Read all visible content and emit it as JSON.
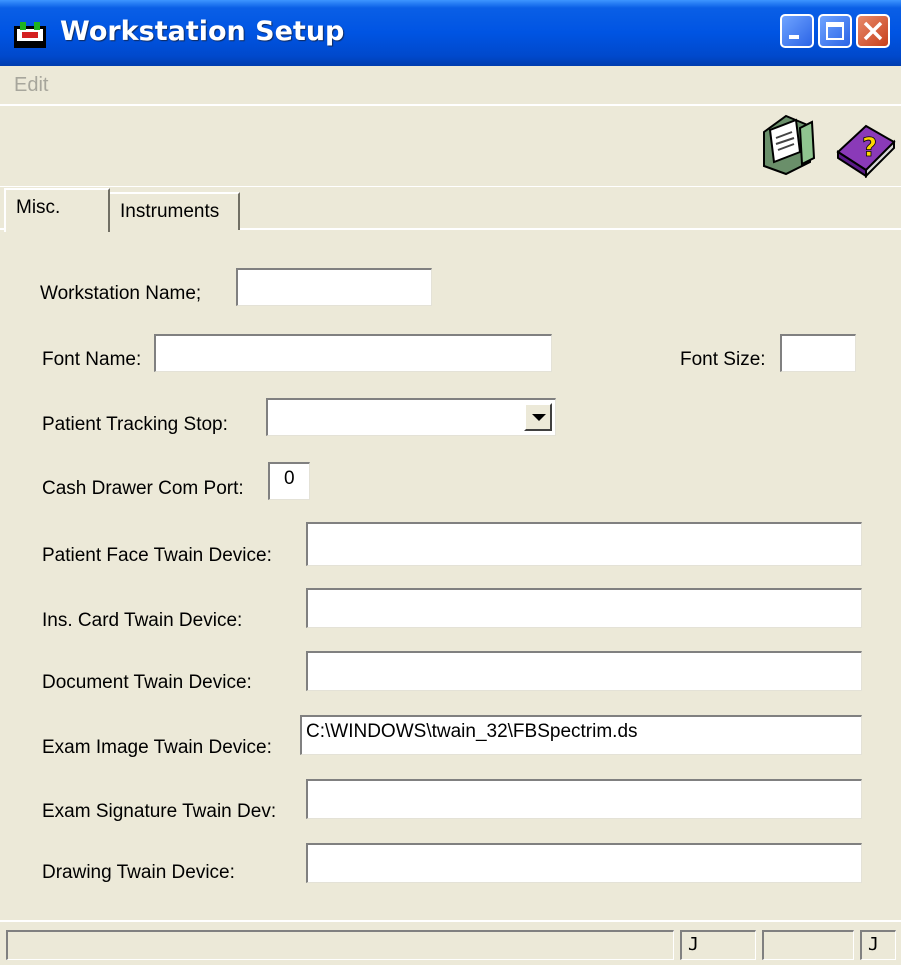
{
  "window": {
    "title": "Workstation Setup"
  },
  "menu": {
    "edit": "Edit"
  },
  "toolbar": {
    "print_icon": "printer-icon",
    "help_icon": "help-book-icon"
  },
  "tabs": [
    {
      "label": "Misc."
    },
    {
      "label": "Instruments"
    }
  ],
  "form": {
    "workstation_name": {
      "label": "Workstation Name;",
      "value": ""
    },
    "font_name": {
      "label": "Font Name:",
      "value": ""
    },
    "font_size": {
      "label": "Font Size:",
      "value": ""
    },
    "patient_tracking_stop": {
      "label": "Patient Tracking Stop:",
      "value": ""
    },
    "cash_drawer_com_port": {
      "label": "Cash Drawer Com Port:",
      "value": "0"
    },
    "patient_face_twain": {
      "label": "Patient Face Twain Device:",
      "value": ""
    },
    "ins_card_twain": {
      "label": "Ins. Card Twain Device:",
      "value": ""
    },
    "document_twain": {
      "label": "Document Twain Device:",
      "value": ""
    },
    "exam_image_twain": {
      "label": "Exam Image Twain Device:",
      "value": "C:\\WINDOWS\\twain_32\\FBSpectrim.ds"
    },
    "exam_signature_twain": {
      "label": "Exam Signature Twain Dev:",
      "value": ""
    },
    "drawing_twain": {
      "label": "Drawing Twain Device:",
      "value": ""
    }
  },
  "status": {
    "panel1": "",
    "panel2": "J",
    "panel3": "",
    "panel4": "J"
  }
}
